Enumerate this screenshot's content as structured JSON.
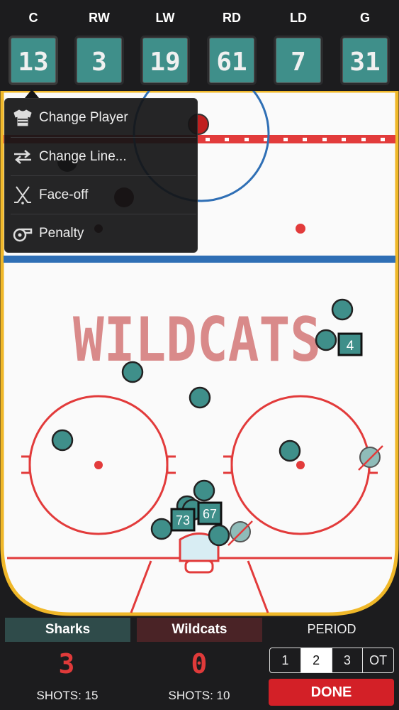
{
  "positions": [
    {
      "label": "C",
      "number": "13"
    },
    {
      "label": "RW",
      "number": "3"
    },
    {
      "label": "LW",
      "number": "19"
    },
    {
      "label": "RD",
      "number": "61"
    },
    {
      "label": "LD",
      "number": "7"
    },
    {
      "label": "G",
      "number": "31"
    }
  ],
  "rink": {
    "center_text": "WILDCATS",
    "tags": [
      "4",
      "73",
      "67"
    ]
  },
  "menu": {
    "items": [
      {
        "label": "Change Player",
        "icon": "jersey-icon"
      },
      {
        "label": "Change Line...",
        "icon": "swap-arrows-icon"
      },
      {
        "label": "Face-off",
        "icon": "crossed-sticks-icon"
      },
      {
        "label": "Penalty",
        "icon": "whistle-icon"
      }
    ]
  },
  "scoreboard": {
    "home": {
      "name": "Sharks",
      "score": "3",
      "shots": "SHOTS: 15",
      "color": "#2f4b4a"
    },
    "away": {
      "name": "Wildcats",
      "score": "0",
      "shots": "SHOTS: 10",
      "color": "#4a2326"
    },
    "period_label": "PERIOD",
    "periods": [
      "1",
      "2",
      "3",
      "OT"
    ],
    "active_period": "2",
    "done_label": "DONE"
  },
  "colors": {
    "teal": "#3f8f8a",
    "rink_red": "#e23b3b",
    "rink_blue": "#2f6fb5",
    "board_yellow": "#f0b829",
    "done_red": "#d32027"
  }
}
